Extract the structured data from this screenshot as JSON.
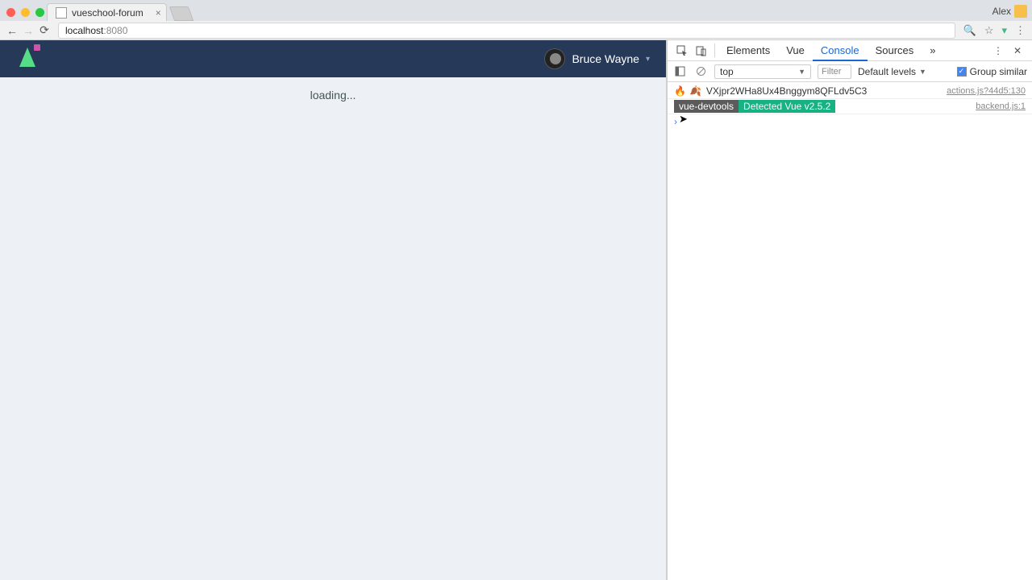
{
  "browser": {
    "tab_title": "vueschool-forum",
    "address_host": "localhost",
    "address_port": ":8080",
    "profile_name": "Alex"
  },
  "app": {
    "username": "Bruce Wayne",
    "loading_text": "loading..."
  },
  "devtools": {
    "tabs": {
      "elements": "Elements",
      "vue": "Vue",
      "console": "Console",
      "sources": "Sources",
      "overflow": "»"
    },
    "toolbar": {
      "context": "top",
      "filter_placeholder": "Filter",
      "levels": "Default levels",
      "group_similar": "Group similar"
    },
    "logs": [
      {
        "icons": [
          "🔥",
          "🍂"
        ],
        "message": "VXjpr2WHa8Ux4Bnggym8QFLdv5C3",
        "source": "actions.js?44d5:130"
      },
      {
        "badge1": "vue-devtools",
        "badge2": "Detected Vue v2.5.2",
        "source": "backend.js:1"
      }
    ]
  }
}
